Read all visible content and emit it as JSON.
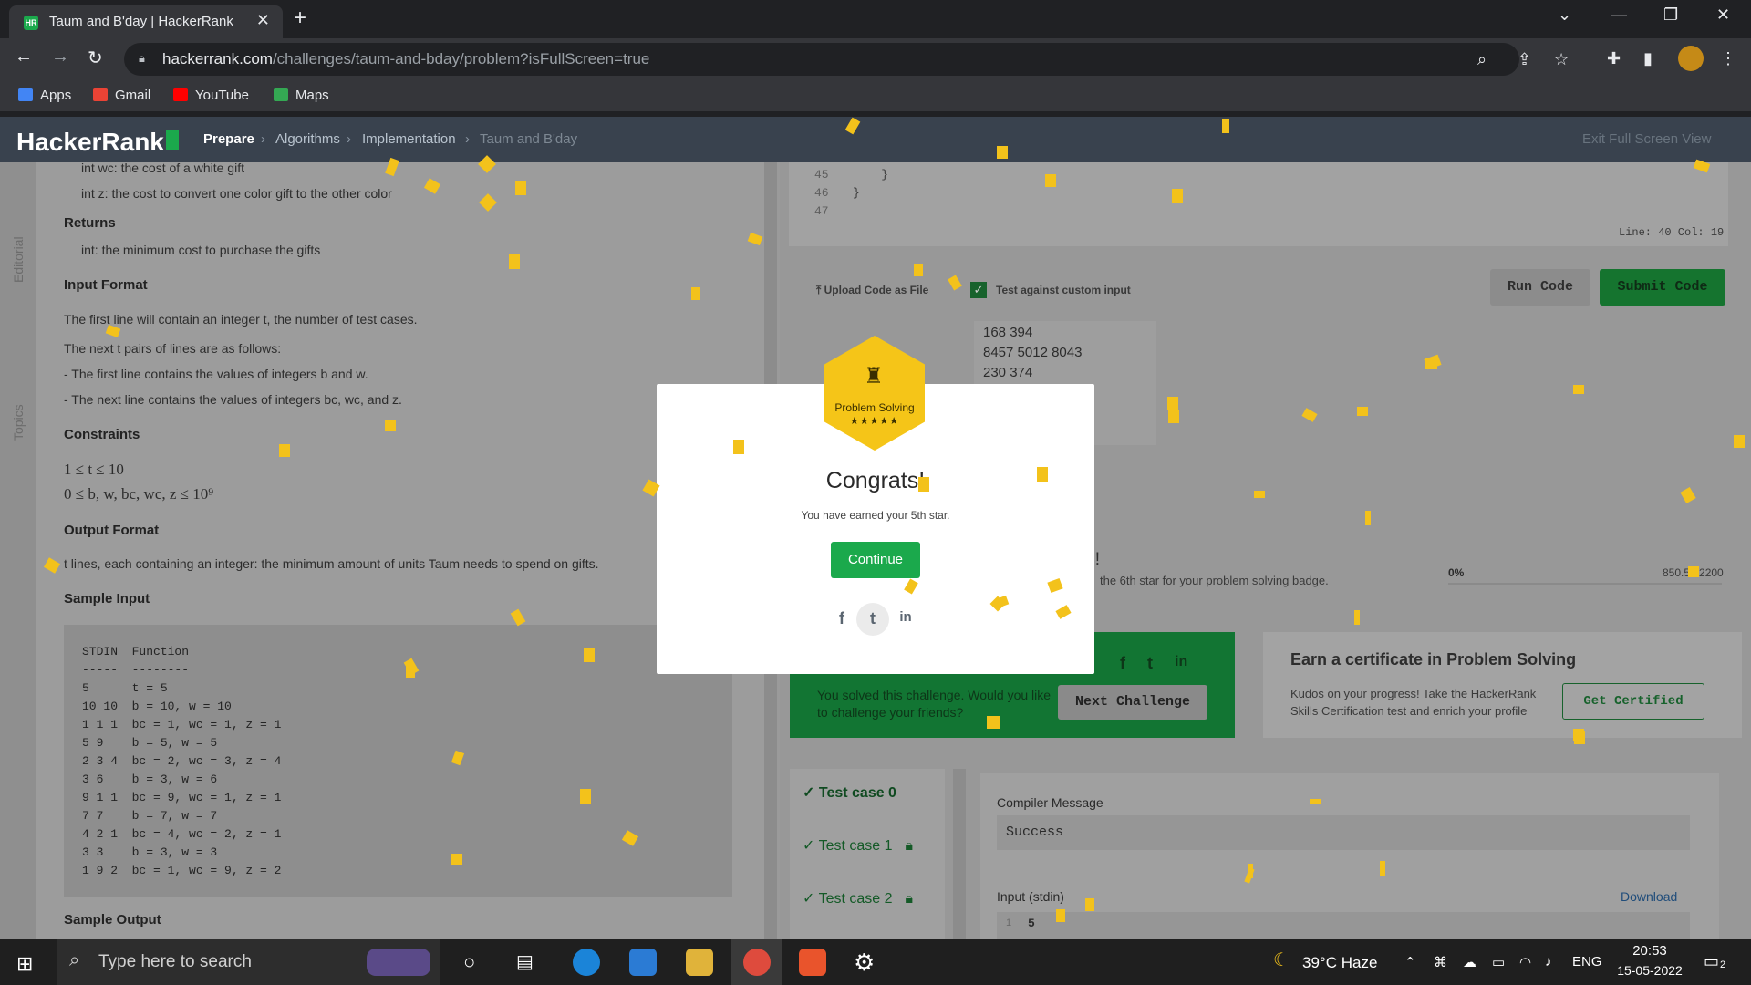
{
  "browser": {
    "tab_title": "Taum and B'day | HackerRank",
    "url_domain": "hackerrank.com",
    "url_path": "/challenges/taum-and-bday/problem?isFullScreen=true",
    "bookmarks": [
      "Apps",
      "Gmail",
      "YouTube",
      "Maps"
    ]
  },
  "header": {
    "logo": "HackerRank",
    "breadcrumbs": [
      "Prepare",
      "Algorithms",
      "Implementation",
      "Taum and B'day"
    ],
    "exit_fullscreen": "Exit Full Screen View"
  },
  "rail": {
    "editorial": "Editorial",
    "topics": "Topics"
  },
  "problem": {
    "param_wc": "int wc: the cost of a white gift",
    "param_z": "int z: the cost to convert one color gift to the other color",
    "returns_title": "Returns",
    "returns_item": "int: the minimum cost to purchase the gifts",
    "input_format_title": "Input Format",
    "input_line1": "The first line will contain an integer t, the number of test cases.",
    "input_line2": "The next t pairs of lines are as follows:",
    "input_line3": "- The first line contains the values of integers b and w.",
    "input_line4": "- The next line contains the values of integers bc, wc, and z.",
    "constraints_title": "Constraints",
    "constraint1": "1 ≤ t ≤ 10",
    "constraint2": "0 ≤ b, w, bc, wc, z ≤ 10⁹",
    "output_format_title": "Output Format",
    "output_line": "t lines, each containing an integer: the minimum amount of units Taum needs to spend on gifts.",
    "sample_input_title": "Sample Input",
    "sample_output_title": "Sample Output",
    "sample_input_code": "STDIN  Function\n-----  --------\n5      t = 5\n10 10  b = 10, w = 10\n1 1 1  bc = 1, wc = 1, z = 1\n5 9    b = 5, w = 5\n2 3 4  bc = 2, wc = 3, z = 4\n3 6    b = 3, w = 6\n9 1 1  bc = 9, wc = 1, z = 1\n7 7    b = 7, w = 7\n4 2 1  bc = 4, wc = 2, z = 1\n3 3    b = 3, w = 3\n1 9 2  bc = 1, wc = 9, z = 2"
  },
  "editor": {
    "line_numbers": [
      "45",
      "46",
      "47"
    ],
    "line45": "    }",
    "line46": "}",
    "status": "Line: 40 Col: 19",
    "upload_label": "Upload Code as File",
    "custom_input_label": "Test against custom input",
    "run_code": "Run Code",
    "submit_code": "Submit Code",
    "custom_input_lines": [
      "168 394",
      "8457 5012 8043",
      "230 374"
    ]
  },
  "progress": {
    "heading_fragment": "ts!",
    "sub_fragment": "the 6th star for your problem solving badge.",
    "percent": "0%",
    "score": "850.51/2200"
  },
  "banner": {
    "text": "You solved this challenge. Would you like to challenge your friends?",
    "next_challenge": "Next Challenge"
  },
  "certificate": {
    "title": "Earn a certificate in Problem Solving",
    "text": "Kudos on your progress! Take the HackerRank Skills Certification test and enrich your profile",
    "button": "Get Certified"
  },
  "tests": {
    "cases": [
      "Test case 0",
      "Test case 1",
      "Test case 2"
    ],
    "compiler_label": "Compiler Message",
    "compiler_value": "Success",
    "input_label": "Input (stdin)",
    "download": "Download",
    "input_line_no": "1",
    "input_first": "5"
  },
  "modal": {
    "badge_category": "Problem Solving",
    "badge_stars": "★★★★★",
    "title": "Congrats!",
    "message": "You have earned your 5th star.",
    "continue": "Continue"
  },
  "taskbar": {
    "search_placeholder": "Type here to search",
    "weather": "39°C  Haze",
    "language": "ENG",
    "time": "20:53",
    "date": "15-05-2022",
    "notifications": "2"
  },
  "colors": {
    "accent_green": "#1ba94c",
    "confetti": "#f3c21b",
    "header_bg": "#39424e"
  }
}
